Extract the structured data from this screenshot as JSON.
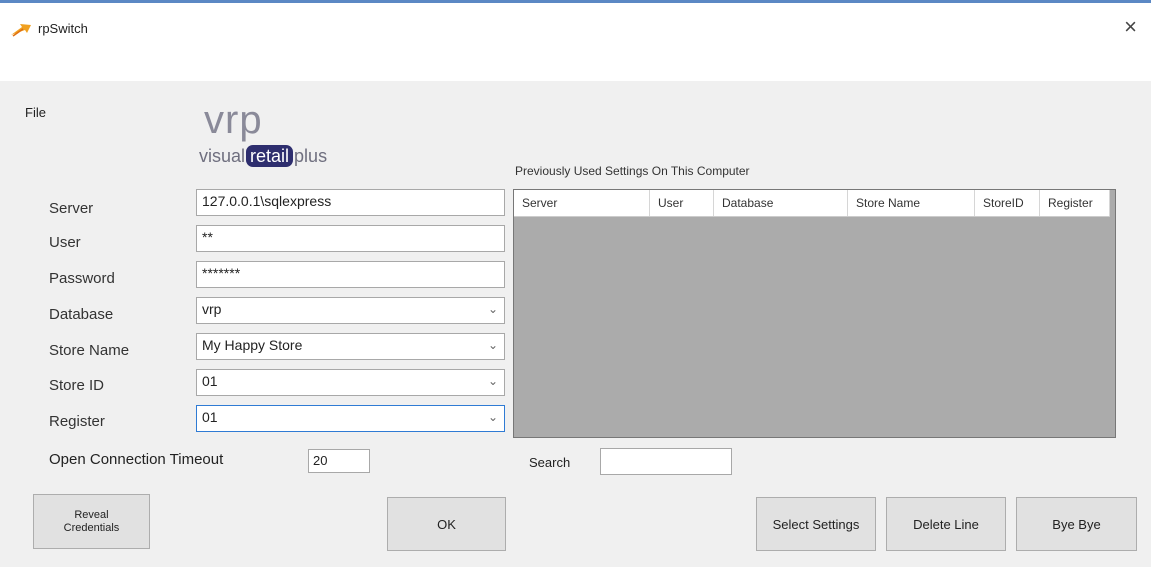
{
  "window": {
    "title": "rpSwitch",
    "icon": "app-arrow-icon",
    "close_glyph": "×"
  },
  "menu": {
    "items": [
      "File"
    ]
  },
  "logo": {
    "wordmark": "vrp",
    "tag_before": "visual",
    "tag_highlight": "retail",
    "tag_after": "plus"
  },
  "form": {
    "server": {
      "label": "Server",
      "value": "127.0.0.1\\sqlexpress"
    },
    "user": {
      "label": "User",
      "value": "**"
    },
    "password": {
      "label": "Password",
      "value": "*******"
    },
    "database": {
      "label": "Database",
      "value": "vrp"
    },
    "store_name": {
      "label": "Store Name",
      "value": "My Happy Store"
    },
    "store_id": {
      "label": "Store ID",
      "value": "01"
    },
    "register": {
      "label": "Register",
      "value": "01"
    },
    "timeout": {
      "label": "Open Connection Timeout",
      "value": "20"
    }
  },
  "grid": {
    "caption": "Previously Used Settings On This Computer",
    "columns": [
      "Server",
      "User",
      "Database",
      "Store Name",
      "StoreID",
      "Register"
    ],
    "rows": []
  },
  "search": {
    "label": "Search",
    "value": ""
  },
  "buttons": {
    "reveal_line1": "Reveal",
    "reveal_line2": "Credentials",
    "ok": "OK",
    "select": "Select Settings",
    "delete": "Delete Line",
    "bye": "Bye Bye"
  },
  "colors": {
    "grid_background": "#ababab",
    "title_accent": "#5b88c4",
    "logo_pill": "#2e2e6e"
  }
}
